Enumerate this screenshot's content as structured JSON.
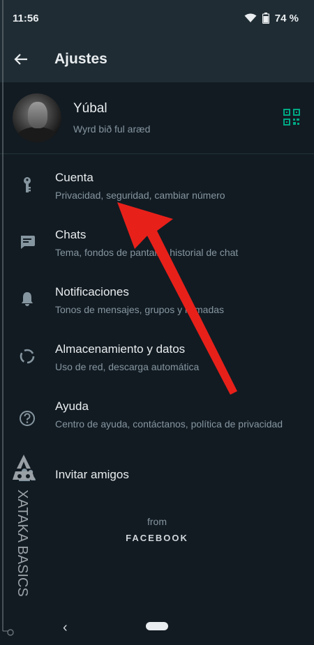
{
  "status_bar": {
    "time": "11:56",
    "battery": "74 %"
  },
  "app_bar": {
    "title": "Ajustes"
  },
  "profile": {
    "name": "Yúbal",
    "status": "Wyrd bið ful aræd"
  },
  "settings": [
    {
      "label": "Cuenta",
      "sub": "Privacidad, seguridad, cambiar número",
      "icon": "key-icon"
    },
    {
      "label": "Chats",
      "sub": "Tema, fondos de pantalla, historial de chat",
      "icon": "chat-icon"
    },
    {
      "label": "Notificaciones",
      "sub": "Tonos de mensajes, grupos y llamadas",
      "icon": "bell-icon"
    },
    {
      "label": "Almacenamiento y datos",
      "sub": "Uso de red, descarga automática",
      "icon": "data-usage-icon"
    },
    {
      "label": "Ayuda",
      "sub": "Centro de ayuda, contáctanos, política de privacidad",
      "icon": "help-icon"
    },
    {
      "label": "Invitar amigos",
      "icon": "people-icon"
    }
  ],
  "footer": {
    "from": "from",
    "brand": "FACEBOOK"
  },
  "watermark": {
    "text": "XATAKA BASICS"
  },
  "colors": {
    "accent": "#00a884",
    "arrow": "#e8201a",
    "background": "#121b22",
    "bar": "#1f2c34"
  }
}
